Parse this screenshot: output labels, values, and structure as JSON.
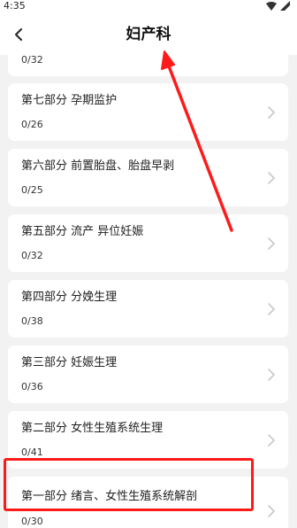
{
  "status": {
    "time": "4:35"
  },
  "header": {
    "title": "妇产科"
  },
  "partial_item": {
    "progress": "0/32"
  },
  "items": [
    {
      "title": "第七部分  孕期监护",
      "progress": "0/26"
    },
    {
      "title": "第六部分  前置胎盘、胎盘早剥",
      "progress": "0/25"
    },
    {
      "title": "第五部分  流产  异位妊娠",
      "progress": "0/32"
    },
    {
      "title": "第四部分  分娩生理",
      "progress": "0/38"
    },
    {
      "title": "第三部分  妊娠生理",
      "progress": "0/36"
    },
    {
      "title": "第二部分  女性生殖系统生理",
      "progress": "0/41"
    },
    {
      "title": "第一部分  绪言、女性生殖系统解剖",
      "progress": "0/30"
    }
  ],
  "annotation": {
    "color": "#ff1a1a"
  }
}
